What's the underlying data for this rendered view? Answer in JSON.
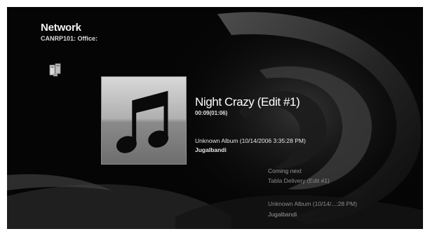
{
  "header": {
    "title": "Network",
    "subtitle": "CANRP101: Office:"
  },
  "icons": {
    "device": "library-device-icon",
    "album_art": "music-note-icon"
  },
  "now_playing": {
    "title": "Night Crazy (Edit #1)",
    "time": "00:09(01:06)",
    "album": "Unknown Album (10/14/2006 3:35:28 PM)",
    "artist": "Jugalbandi"
  },
  "coming_next": {
    "label": "Coming next",
    "title": "Tabla Delivery (Edit #1)",
    "album": "Unknown Album (10/14/...:28 PM)",
    "artist": "Jugalbandi"
  },
  "colors": {
    "background": "#050505",
    "text_primary": "#ffffff",
    "text_dim": "#8c8c8c"
  }
}
